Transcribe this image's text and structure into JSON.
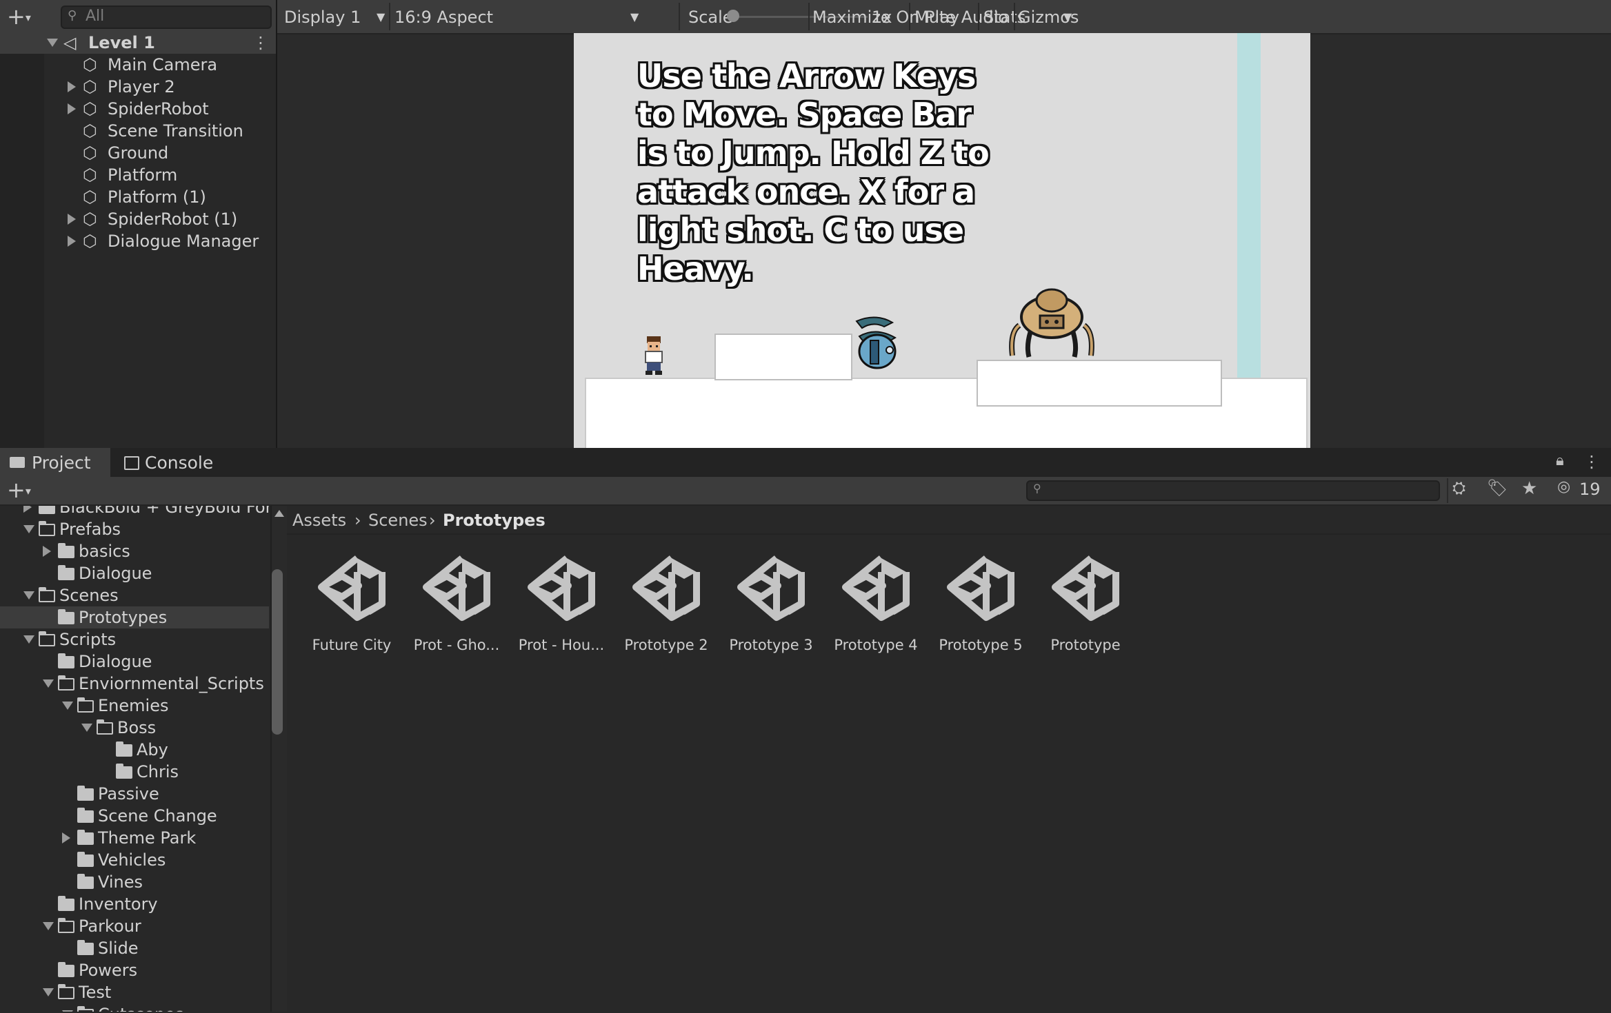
{
  "hierarchy": {
    "search_placeholder": "All",
    "scene": "Level 1",
    "items": [
      {
        "label": "Main Camera",
        "expandable": false
      },
      {
        "label": "Player 2",
        "expandable": true
      },
      {
        "label": "SpiderRobot",
        "expandable": true
      },
      {
        "label": "Scene Transition",
        "expandable": false
      },
      {
        "label": "Ground",
        "expandable": false
      },
      {
        "label": "Platform",
        "expandable": false
      },
      {
        "label": "Platform (1)",
        "expandable": false
      },
      {
        "label": "SpiderRobot (1)",
        "expandable": true
      },
      {
        "label": "Dialogue Manager",
        "expandable": true
      }
    ]
  },
  "game_toolbar": {
    "display": "Display 1",
    "aspect": "16:9 Aspect",
    "scale_label": "Scale",
    "scale_value": "1x",
    "maximize": "Maximize On Play",
    "mute": "Mute Audio",
    "stats": "Stats",
    "gizmos": "Gizmos"
  },
  "game_view": {
    "instructions": "Use the Arrow Keys to Move. Space Bar is to Jump. Hold Z to attack once. X for a light shot. C to use Heavy."
  },
  "bottom_tabs": {
    "project": "Project",
    "console": "Console"
  },
  "project": {
    "hidden_count": "19",
    "tree": [
      {
        "label": "BlackBold + GreyBold For",
        "open": false,
        "arrow": "right"
      },
      {
        "label": "Prefabs",
        "open": true,
        "arrow": "down"
      },
      {
        "label": "basics",
        "open": false,
        "arrow": "right"
      },
      {
        "label": "Dialogue",
        "open": false,
        "arrow": ""
      },
      {
        "label": "Scenes",
        "open": true,
        "arrow": "down"
      },
      {
        "label": "Prototypes",
        "open": false,
        "arrow": "",
        "selected": true
      },
      {
        "label": "Scripts",
        "open": true,
        "arrow": "down"
      },
      {
        "label": "Dialogue",
        "open": false,
        "arrow": ""
      },
      {
        "label": "Enviornmental_Scripts",
        "open": true,
        "arrow": "down"
      },
      {
        "label": "Enemies",
        "open": true,
        "arrow": "down"
      },
      {
        "label": "Boss",
        "open": true,
        "arrow": "down"
      },
      {
        "label": "Aby",
        "open": false,
        "arrow": ""
      },
      {
        "label": "Chris",
        "open": false,
        "arrow": ""
      },
      {
        "label": "Passive",
        "open": false,
        "arrow": ""
      },
      {
        "label": "Scene Change",
        "open": false,
        "arrow": ""
      },
      {
        "label": "Theme Park",
        "open": false,
        "arrow": "right"
      },
      {
        "label": "Vehicles",
        "open": false,
        "arrow": ""
      },
      {
        "label": "Vines",
        "open": false,
        "arrow": ""
      },
      {
        "label": "Inventory",
        "open": false,
        "arrow": ""
      },
      {
        "label": "Parkour",
        "open": true,
        "arrow": "down"
      },
      {
        "label": "Slide",
        "open": false,
        "arrow": ""
      },
      {
        "label": "Powers",
        "open": false,
        "arrow": ""
      },
      {
        "label": "Test",
        "open": true,
        "arrow": "down"
      },
      {
        "label": "Cutscenes",
        "open": true,
        "arrow": "down"
      }
    ],
    "breadcrumb": [
      "Assets",
      "Scenes",
      "Prototypes"
    ],
    "assets": [
      "Future City",
      "Prot - Gho...",
      "Prot - Hou...",
      "Prototype 2",
      "Prototype 3",
      "Prototype 4",
      "Prototype 5",
      "Prototype"
    ]
  }
}
